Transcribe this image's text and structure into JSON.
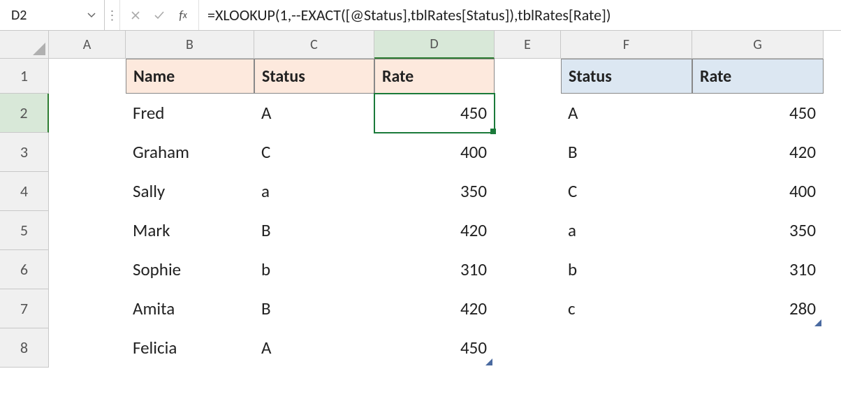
{
  "name_box": "D2",
  "formula": "=XLOOKUP(1,--EXACT([@Status],tblRates[Status]),tblRates[Rate])",
  "columns": [
    "A",
    "B",
    "C",
    "D",
    "E",
    "F",
    "G"
  ],
  "rows": [
    "1",
    "2",
    "3",
    "4",
    "5",
    "6",
    "7",
    "8"
  ],
  "active_cell": "D2",
  "table1": {
    "headers": {
      "name": "Name",
      "status": "Status",
      "rate": "Rate"
    },
    "rows": [
      {
        "name": "Fred",
        "status": "A",
        "rate": "450"
      },
      {
        "name": "Graham",
        "status": "C",
        "rate": "400"
      },
      {
        "name": "Sally",
        "status": "a",
        "rate": "350"
      },
      {
        "name": "Mark",
        "status": "B",
        "rate": "420"
      },
      {
        "name": "Sophie",
        "status": "b",
        "rate": "310"
      },
      {
        "name": "Amita",
        "status": "B",
        "rate": "420"
      },
      {
        "name": "Felicia",
        "status": "A",
        "rate": "450"
      }
    ]
  },
  "table2": {
    "headers": {
      "status": "Status",
      "rate": "Rate"
    },
    "rows": [
      {
        "status": "A",
        "rate": "450"
      },
      {
        "status": "B",
        "rate": "420"
      },
      {
        "status": "C",
        "rate": "400"
      },
      {
        "status": "a",
        "rate": "350"
      },
      {
        "status": "b",
        "rate": "310"
      },
      {
        "status": "c",
        "rate": "280"
      }
    ]
  }
}
